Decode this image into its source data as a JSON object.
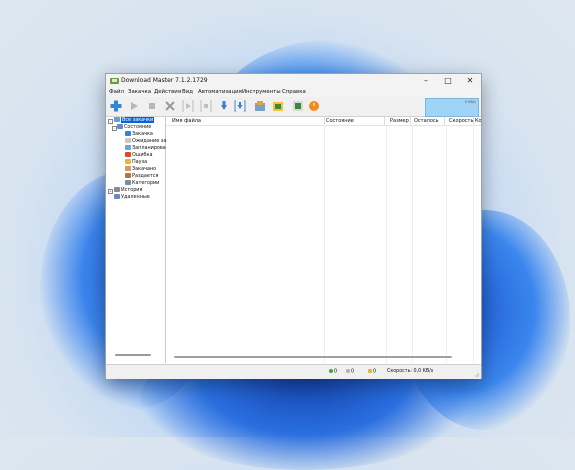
{
  "window": {
    "title": "Download Master 7.1.2.1729"
  },
  "menu": [
    "Файл",
    "Закачка",
    "Действия",
    "Вид",
    "Автоматизация",
    "Инструменты",
    "Справка"
  ],
  "toolbar": {
    "speed_graph_label": "0 KB/s",
    "buttons": [
      "add-download",
      "start",
      "stop",
      "delete",
      "start-queue",
      "stop-queue",
      "move-down",
      "download-all",
      "site-manager",
      "video-grabber",
      "scheduler",
      "exit-power"
    ]
  },
  "tree": {
    "items": [
      {
        "label": "Все закачки",
        "icon": "folder-icon"
      },
      {
        "label": "Состояние",
        "icon": "state-icon"
      },
      {
        "label": "Закачка",
        "icon": "downloading-icon"
      },
      {
        "label": "Ожидание зак",
        "icon": "waiting-icon"
      },
      {
        "label": "Запланирова",
        "icon": "scheduled-icon"
      },
      {
        "label": "Ошибка",
        "icon": "error-icon"
      },
      {
        "label": "Пауза",
        "icon": "pause-icon"
      },
      {
        "label": "Закачано",
        "icon": "done-icon"
      },
      {
        "label": "Раздается",
        "icon": "seeding-icon"
      },
      {
        "label": "Категории",
        "icon": "categories-icon"
      },
      {
        "label": "История",
        "icon": "history-icon"
      },
      {
        "label": "Удаленные",
        "icon": "trash-icon"
      }
    ]
  },
  "list": {
    "columns": [
      "Имя файла",
      "Состояние",
      "Размер",
      "Осталось",
      "Скорость",
      "Ко"
    ]
  },
  "status": {
    "active": "0",
    "waiting": "0",
    "paused": "0",
    "speed": "Скорость: 0,0 KB/s"
  }
}
